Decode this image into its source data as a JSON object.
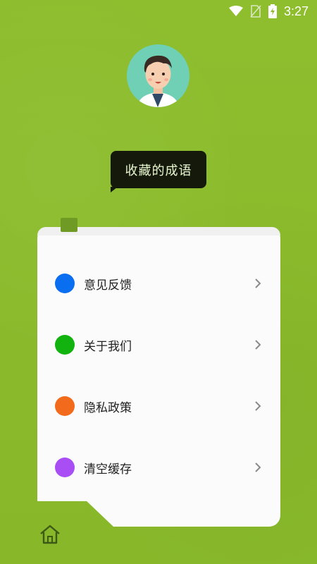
{
  "status_bar": {
    "time": "3:27",
    "icons": [
      "wifi-icon",
      "no-sim-icon",
      "battery-charging-icon"
    ]
  },
  "header": {
    "avatar": "avatar-icon",
    "title": "收藏的成语"
  },
  "menu": {
    "items": [
      {
        "label": "意见反馈",
        "color": "#0a6ef0",
        "icon": "chevron-right-icon"
      },
      {
        "label": "关于我们",
        "color": "#12b30f",
        "icon": "chevron-right-icon"
      },
      {
        "label": "隐私政策",
        "color": "#f26b1d",
        "icon": "chevron-right-icon"
      },
      {
        "label": "清空缓存",
        "color": "#a94df5",
        "icon": "chevron-right-icon"
      }
    ]
  },
  "bottom_nav": {
    "icon": "home-icon"
  },
  "colors": {
    "background": "#8bbb2c",
    "bubble": "#14190c",
    "card": "#fbfbfb"
  }
}
